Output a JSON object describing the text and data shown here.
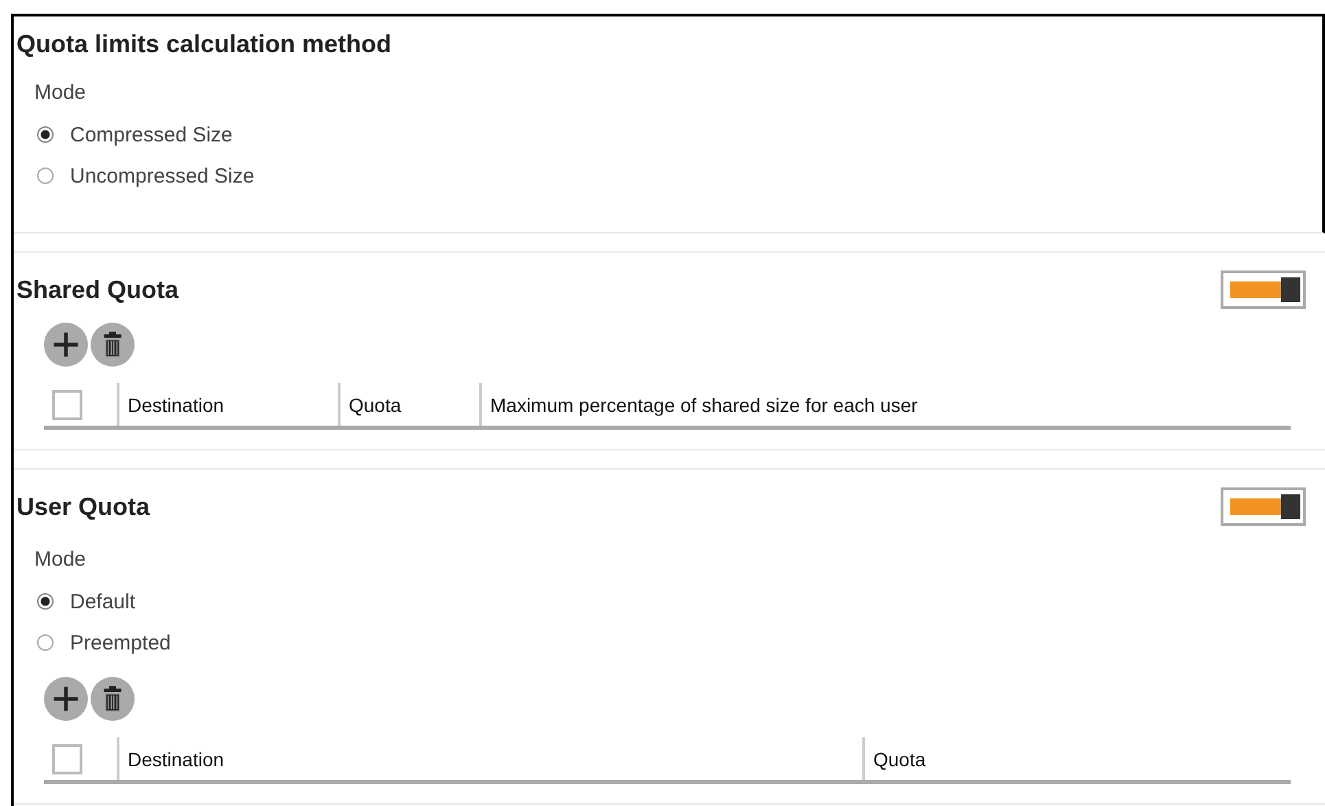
{
  "sections": [
    {
      "title": "Quota limits calculation method",
      "mode_label": "Mode",
      "modes": [
        {
          "label": "Compressed Size",
          "selected": true
        },
        {
          "label": "Uncompressed Size",
          "selected": false
        }
      ]
    },
    {
      "title": "Shared Quota",
      "toggle": {
        "on": true
      },
      "table": {
        "select_all": {
          "checked": false
        },
        "columns": [
          {
            "label": "Destination"
          },
          {
            "label": "Quota"
          },
          {
            "label": "Maximum percentage of shared size for each user"
          }
        ]
      }
    },
    {
      "title": "User Quota",
      "toggle": {
        "on": true
      },
      "mode_label": "Mode",
      "modes": [
        {
          "label": "Default",
          "selected": true
        },
        {
          "label": "Preempted",
          "selected": false
        }
      ],
      "table": {
        "select_all": {
          "checked": false
        },
        "columns": [
          {
            "label": "Destination"
          },
          {
            "label": "Quota"
          }
        ]
      }
    }
  ]
}
